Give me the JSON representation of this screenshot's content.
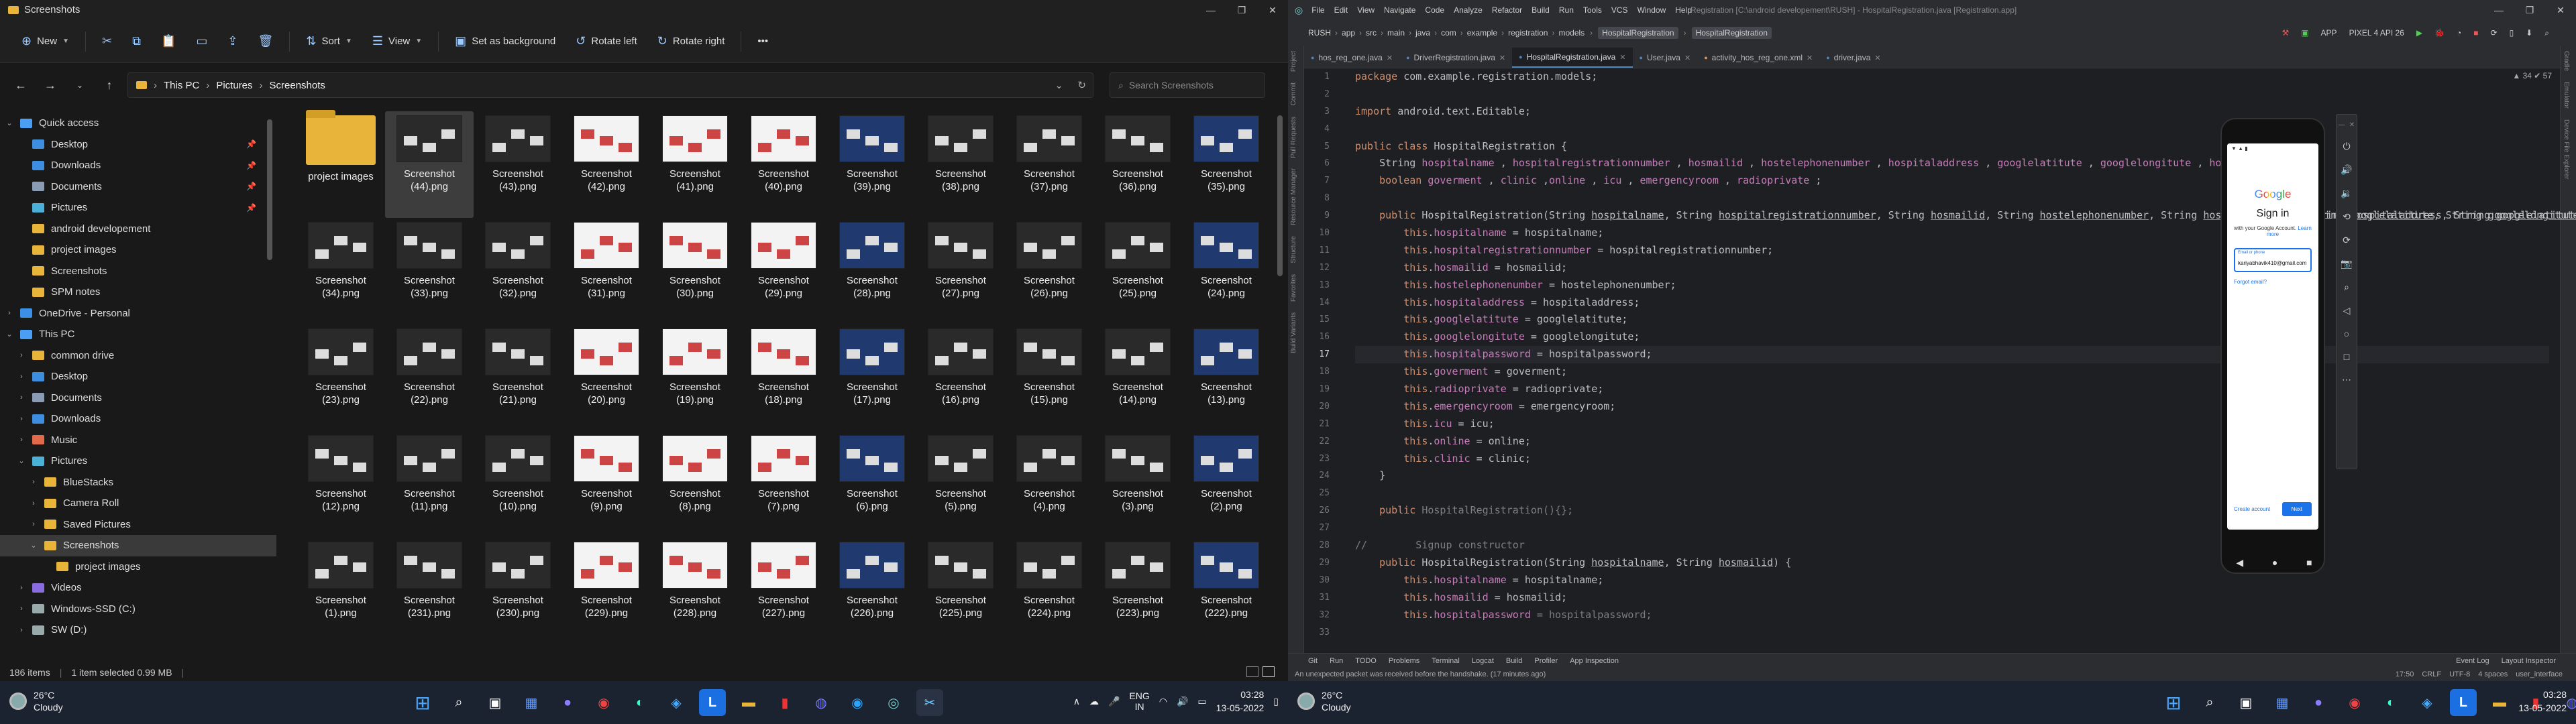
{
  "explorer": {
    "window_title": "Screenshots",
    "toolbar": {
      "new": "New",
      "sort": "Sort",
      "view": "View",
      "set_background": "Set as background",
      "rotate_left": "Rotate left",
      "rotate_right": "Rotate right"
    },
    "breadcrumb": [
      "This PC",
      "Pictures",
      "Screenshots"
    ],
    "search_placeholder": "Search Screenshots",
    "nav": [
      {
        "label": "Quick access",
        "indent": 0,
        "arrow": "v",
        "color": "#4a9ff5"
      },
      {
        "label": "Desktop",
        "indent": 1,
        "pin": true,
        "color": "#3d8ee0"
      },
      {
        "label": "Downloads",
        "indent": 1,
        "pin": true,
        "color": "#3d8ee0"
      },
      {
        "label": "Documents",
        "indent": 1,
        "pin": true,
        "color": "#8a9bb5"
      },
      {
        "label": "Pictures",
        "indent": 1,
        "pin": true,
        "color": "#4bb0d8"
      },
      {
        "label": "android developement",
        "indent": 1,
        "color": "#e8b43a"
      },
      {
        "label": "project images",
        "indent": 1,
        "color": "#e8b43a"
      },
      {
        "label": "Screenshots",
        "indent": 1,
        "color": "#e8b43a"
      },
      {
        "label": "SPM notes",
        "indent": 1,
        "color": "#e8b43a"
      },
      {
        "label": "OneDrive - Personal",
        "indent": 0,
        "arrow": ">",
        "color": "#3b8fe6"
      },
      {
        "label": "This PC",
        "indent": 0,
        "arrow": "v",
        "color": "#4a9ff5"
      },
      {
        "label": "common drive",
        "indent": 1,
        "arrow": ">",
        "color": "#e8b43a"
      },
      {
        "label": "Desktop",
        "indent": 1,
        "arrow": ">",
        "color": "#3d8ee0"
      },
      {
        "label": "Documents",
        "indent": 1,
        "arrow": ">",
        "color": "#8a9bb5"
      },
      {
        "label": "Downloads",
        "indent": 1,
        "arrow": ">",
        "color": "#3d8ee0"
      },
      {
        "label": "Music",
        "indent": 1,
        "arrow": ">",
        "color": "#e06a4a"
      },
      {
        "label": "Pictures",
        "indent": 1,
        "arrow": "v",
        "color": "#4bb0d8"
      },
      {
        "label": "BlueStacks",
        "indent": 2,
        "arrow": ">",
        "color": "#e8b43a"
      },
      {
        "label": "Camera Roll",
        "indent": 2,
        "arrow": ">",
        "color": "#e8b43a"
      },
      {
        "label": "Saved Pictures",
        "indent": 2,
        "arrow": ">",
        "color": "#e8b43a"
      },
      {
        "label": "Screenshots",
        "indent": 2,
        "arrow": "v",
        "color": "#e8b43a",
        "selected": true
      },
      {
        "label": "project images",
        "indent": 3,
        "color": "#e8b43a"
      },
      {
        "label": "Videos",
        "indent": 1,
        "arrow": ">",
        "color": "#8a6be0"
      },
      {
        "label": "Windows-SSD (C:)",
        "indent": 1,
        "arrow": ">",
        "color": "#9aa"
      },
      {
        "label": "SW (D:)",
        "indent": 1,
        "arrow": ">",
        "color": "#9aa"
      }
    ],
    "files": [
      {
        "name": "project images",
        "folder": true
      },
      {
        "name": "Screenshot (44).png",
        "selected": true
      },
      {
        "name": "Screenshot (43).png"
      },
      {
        "name": "Screenshot (42).png"
      },
      {
        "name": "Screenshot (41).png"
      },
      {
        "name": "Screenshot (40).png"
      },
      {
        "name": "Screenshot (39).png"
      },
      {
        "name": "Screenshot (38).png"
      },
      {
        "name": "Screenshot (37).png"
      },
      {
        "name": "Screenshot (36).png"
      },
      {
        "name": "Screenshot (35).png"
      },
      {
        "name": "Screenshot (34).png"
      },
      {
        "name": "Screenshot (33).png"
      },
      {
        "name": "Screenshot (32).png"
      },
      {
        "name": "Screenshot (31).png"
      },
      {
        "name": "Screenshot (30).png"
      },
      {
        "name": "Screenshot (29).png"
      },
      {
        "name": "Screenshot (28).png"
      },
      {
        "name": "Screenshot (27).png"
      },
      {
        "name": "Screenshot (26).png"
      },
      {
        "name": "Screenshot (25).png"
      },
      {
        "name": "Screenshot (24).png"
      },
      {
        "name": "Screenshot (23).png"
      },
      {
        "name": "Screenshot (22).png"
      },
      {
        "name": "Screenshot (21).png"
      },
      {
        "name": "Screenshot (20).png"
      },
      {
        "name": "Screenshot (19).png"
      },
      {
        "name": "Screenshot (18).png"
      },
      {
        "name": "Screenshot (17).png"
      },
      {
        "name": "Screenshot (16).png"
      },
      {
        "name": "Screenshot (15).png"
      },
      {
        "name": "Screenshot (14).png"
      },
      {
        "name": "Screenshot (13).png"
      },
      {
        "name": "Screenshot (12).png"
      },
      {
        "name": "Screenshot (11).png"
      },
      {
        "name": "Screenshot (10).png"
      },
      {
        "name": "Screenshot (9).png"
      },
      {
        "name": "Screenshot (8).png"
      },
      {
        "name": "Screenshot (7).png"
      },
      {
        "name": "Screenshot (6).png"
      },
      {
        "name": "Screenshot (5).png"
      },
      {
        "name": "Screenshot (4).png"
      },
      {
        "name": "Screenshot (3).png"
      },
      {
        "name": "Screenshot (2).png"
      },
      {
        "name": "Screenshot (1).png"
      },
      {
        "name": "Screenshot (231).png"
      },
      {
        "name": "Screenshot (230).png"
      },
      {
        "name": "Screenshot (229).png"
      },
      {
        "name": "Screenshot (228).png"
      },
      {
        "name": "Screenshot (227).png"
      },
      {
        "name": "Screenshot (226).png"
      },
      {
        "name": "Screenshot (225).png"
      },
      {
        "name": "Screenshot (224).png"
      },
      {
        "name": "Screenshot (223).png"
      },
      {
        "name": "Screenshot (222).png"
      }
    ],
    "status": {
      "count": "186 items",
      "selected": "1 item selected  0.99 MB"
    }
  },
  "taskbar_left": {
    "temp": "26°C",
    "weather": "Cloudy",
    "lang": "ENG",
    "lang2": "IN",
    "time": "03:28",
    "date": "13-05-2022"
  },
  "ide": {
    "menu": [
      "File",
      "Edit",
      "View",
      "Navigate",
      "Code",
      "Analyze",
      "Refactor",
      "Build",
      "Run",
      "Tools",
      "VCS",
      "Window",
      "Help"
    ],
    "title": "Registration [C:\\android developement\\RUSH] - HospitalRegistration.java [Registration.app]",
    "breadcrumb": [
      "RUSH",
      "app",
      "src",
      "main",
      "java",
      "com",
      "example",
      "registration",
      "models"
    ],
    "breadcrumb_class": "HospitalRegistration",
    "breadcrumb_class2": "HospitalRegistration",
    "run_config": "APP",
    "device": "PIXEL 4 API 26",
    "tabs": [
      {
        "label": "hos_reg_one.java"
      },
      {
        "label": "DriverRegistration.java"
      },
      {
        "label": "HospitalRegistration.java",
        "active": true
      },
      {
        "label": "User.java"
      },
      {
        "label": "activity_hos_reg_one.xml"
      },
      {
        "label": "driver.java"
      }
    ],
    "left_strip": [
      "Project",
      "Commit",
      "Pull Requests",
      "Resource Manager",
      "Structure",
      "Favorites",
      "Build Variants"
    ],
    "right_strip": [
      "Gradle",
      "Emulator",
      "Device File Explorer"
    ],
    "inspection": "▲ 34  ✔ 57",
    "current_line": "17",
    "code_lines": [
      [
        {
          "t": "package ",
          "c": "kw"
        },
        {
          "t": "com.example.registration.models;"
        }
      ],
      [],
      [
        {
          "t": "import ",
          "c": "kw"
        },
        {
          "t": "android.text.Editable;"
        }
      ],
      [],
      [
        {
          "t": "public class ",
          "c": "kw"
        },
        {
          "t": "HospitalRegistration {"
        }
      ],
      [
        {
          "t": "    String "
        },
        {
          "t": "hospitalname",
          "c": "fld"
        },
        {
          "t": " , "
        },
        {
          "t": "hospitalregistrationnumber",
          "c": "fld"
        },
        {
          "t": " , "
        },
        {
          "t": "hosmailid",
          "c": "fld"
        },
        {
          "t": " , "
        },
        {
          "t": "hostelephonenumber",
          "c": "fld"
        },
        {
          "t": " , "
        },
        {
          "t": "hospitaladdress",
          "c": "fld"
        },
        {
          "t": " , "
        },
        {
          "t": "googlelatitute",
          "c": "fld"
        },
        {
          "t": " , "
        },
        {
          "t": "googlelongitute",
          "c": "fld"
        },
        {
          "t": " , "
        },
        {
          "t": "hospitalpassword",
          "c": "fld"
        },
        {
          "t": ";"
        }
      ],
      [
        {
          "t": "    "
        },
        {
          "t": "boolean ",
          "c": "kw"
        },
        {
          "t": "goverment",
          "c": "fld"
        },
        {
          "t": " , "
        },
        {
          "t": "clinic",
          "c": "fld"
        },
        {
          "t": " ,"
        },
        {
          "t": "online",
          "c": "fld"
        },
        {
          "t": " , "
        },
        {
          "t": "icu",
          "c": "fld"
        },
        {
          "t": " , "
        },
        {
          "t": "emergencyroom",
          "c": "fld"
        },
        {
          "t": " , "
        },
        {
          "t": "radioprivate",
          "c": "fld"
        },
        {
          "t": " ;"
        }
      ],
      [],
      [
        {
          "t": "    "
        },
        {
          "t": "public ",
          "c": "kw"
        },
        {
          "t": "HospitalRegistration(String "
        },
        {
          "t": "hospitalname",
          "c": "un"
        },
        {
          "t": ", String "
        },
        {
          "t": "hospitalregistrationnumber",
          "c": "un"
        },
        {
          "t": ", String "
        },
        {
          "t": "hosmailid",
          "c": "un"
        },
        {
          "t": ", String "
        },
        {
          "t": "hostelephonenumber",
          "c": "un"
        },
        {
          "t": ", String "
        },
        {
          "t": "hospitaladdress",
          "c": "un"
        },
        {
          "t": ", String "
        },
        {
          "t": "googlelatitute",
          "c": "un"
        },
        {
          "t": ", String "
        },
        {
          "t": "googlelongitute",
          "c": "un"
        },
        {
          "t": ","
        }
      ],
      [
        {
          "t": "        "
        },
        {
          "t": "this",
          "c": "kw"
        },
        {
          "t": "."
        },
        {
          "t": "hospitalname",
          "c": "fld"
        },
        {
          "t": " = hospitalname;"
        }
      ],
      [
        {
          "t": "        "
        },
        {
          "t": "this",
          "c": "kw"
        },
        {
          "t": "."
        },
        {
          "t": "hospitalregistrationnumber",
          "c": "fld"
        },
        {
          "t": " = hospitalregistrationnumber;"
        }
      ],
      [
        {
          "t": "        "
        },
        {
          "t": "this",
          "c": "kw"
        },
        {
          "t": "."
        },
        {
          "t": "hosmailid",
          "c": "fld"
        },
        {
          "t": " = hosmailid;"
        }
      ],
      [
        {
          "t": "        "
        },
        {
          "t": "this",
          "c": "kw"
        },
        {
          "t": "."
        },
        {
          "t": "hostelephonenumber",
          "c": "fld"
        },
        {
          "t": " = hostelephonenumber;"
        }
      ],
      [
        {
          "t": "        "
        },
        {
          "t": "this",
          "c": "kw"
        },
        {
          "t": "."
        },
        {
          "t": "hospitaladdress",
          "c": "fld"
        },
        {
          "t": " = hospitaladdress;"
        }
      ],
      [
        {
          "t": "        "
        },
        {
          "t": "this",
          "c": "kw"
        },
        {
          "t": "."
        },
        {
          "t": "googlelatitute",
          "c": "fld"
        },
        {
          "t": " = googlelatitute;"
        }
      ],
      [
        {
          "t": "        "
        },
        {
          "t": "this",
          "c": "kw"
        },
        {
          "t": "."
        },
        {
          "t": "googlelongitute",
          "c": "fld"
        },
        {
          "t": " = googlelongitute;"
        }
      ],
      [
        {
          "t": "        "
        },
        {
          "t": "this",
          "c": "kw"
        },
        {
          "t": "."
        },
        {
          "t": "hospitalpassword",
          "c": "fld"
        },
        {
          "t": " = hospitalpassword;"
        }
      ],
      [
        {
          "t": "        "
        },
        {
          "t": "this",
          "c": "kw"
        },
        {
          "t": "."
        },
        {
          "t": "goverment",
          "c": "fld"
        },
        {
          "t": " = goverment;"
        }
      ],
      [
        {
          "t": "        "
        },
        {
          "t": "this",
          "c": "kw"
        },
        {
          "t": "."
        },
        {
          "t": "radioprivate",
          "c": "fld"
        },
        {
          "t": " = radioprivate;"
        }
      ],
      [
        {
          "t": "        "
        },
        {
          "t": "this",
          "c": "kw"
        },
        {
          "t": "."
        },
        {
          "t": "emergencyroom",
          "c": "fld"
        },
        {
          "t": " = emergencyroom;"
        }
      ],
      [
        {
          "t": "        "
        },
        {
          "t": "this",
          "c": "kw"
        },
        {
          "t": "."
        },
        {
          "t": "icu",
          "c": "fld"
        },
        {
          "t": " = icu;"
        }
      ],
      [
        {
          "t": "        "
        },
        {
          "t": "this",
          "c": "kw"
        },
        {
          "t": "."
        },
        {
          "t": "online",
          "c": "fld"
        },
        {
          "t": " = online;"
        }
      ],
      [
        {
          "t": "        "
        },
        {
          "t": "this",
          "c": "kw"
        },
        {
          "t": "."
        },
        {
          "t": "clinic",
          "c": "fld"
        },
        {
          "t": " = clinic;"
        }
      ],
      [
        {
          "t": "    }"
        }
      ],
      [],
      [
        {
          "t": "    "
        },
        {
          "t": "public ",
          "c": "kw"
        },
        {
          "t": "HospitalRegistration(){};",
          "c": "cm"
        }
      ],
      [],
      [
        {
          "t": "//        Signup constructor",
          "c": "cm"
        }
      ],
      [
        {
          "t": "    "
        },
        {
          "t": "public ",
          "c": "kw"
        },
        {
          "t": "HospitalRegistration(String "
        },
        {
          "t": "hospitalname",
          "c": "un"
        },
        {
          "t": ", String "
        },
        {
          "t": "hosmailid",
          "c": "un"
        },
        {
          "t": ") {"
        }
      ],
      [
        {
          "t": "        "
        },
        {
          "t": "this",
          "c": "kw"
        },
        {
          "t": "."
        },
        {
          "t": "hospitalname",
          "c": "fld"
        },
        {
          "t": " = hospitalname;"
        }
      ],
      [
        {
          "t": "        "
        },
        {
          "t": "this",
          "c": "kw"
        },
        {
          "t": "."
        },
        {
          "t": "hosmailid",
          "c": "fld"
        },
        {
          "t": " = hosmailid;"
        }
      ],
      [
        {
          "t": "        "
        },
        {
          "t": "this",
          "c": "kw"
        },
        {
          "t": "."
        },
        {
          "t": "hospitalpassword",
          "c": "fld"
        },
        {
          "t": " = hospitalpassword;",
          "c": "cm"
        }
      ],
      []
    ],
    "code_overflow": "r, String hospitaladdress, String googlelatitute, String googlelongitute,",
    "bottom_tools": [
      "Git",
      "Run",
      "TODO",
      "Problems",
      "Terminal",
      "Logcat",
      "Build",
      "Profiler",
      "App Inspection"
    ],
    "bottom_right": [
      "Event Log",
      "Layout Inspector"
    ],
    "status_msg": "An unexpected packet was received before the handshake. (17 minutes ago)",
    "status_right": [
      "17:50",
      "CRLF",
      "UTF-8",
      "4 spaces",
      "user_interface"
    ]
  },
  "phone": {
    "google": "Google",
    "signin": "Sign in",
    "sub": "with your Google Account.",
    "learn_more": "Learn more",
    "email_label": "Email or phone",
    "email": "kariyabhavik410@gmail.com",
    "forgot": "Forgot email?",
    "create": "Create account",
    "next": "Next"
  },
  "taskbar_right": {
    "temp": "26°C",
    "weather": "Cloudy",
    "time": "03:28",
    "date": "13-05-2022"
  }
}
